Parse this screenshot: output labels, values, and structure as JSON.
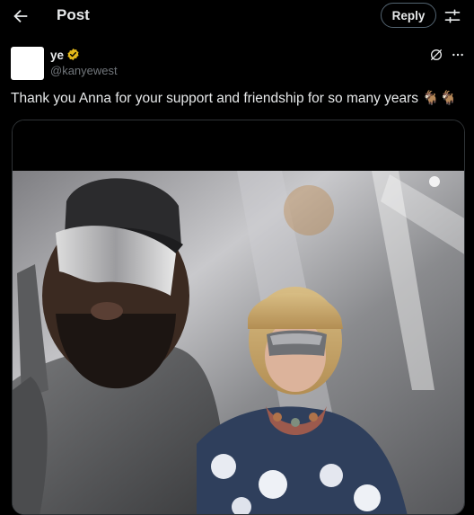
{
  "header": {
    "title": "Post",
    "reply_label": "Reply",
    "back_icon": "arrow-left-icon",
    "settings_icon": "sliders-icon"
  },
  "post": {
    "author_name": "ye",
    "author_handle": "@kanyewest",
    "verified_icon": "verified-badge-icon",
    "text": "Thank you Anna for your support and friendship for so many years 🐐🐐",
    "grok_icon": "grok-icon",
    "more_icon": "more-icon"
  },
  "colors": {
    "background": "#000000",
    "text": "#e7e9ea",
    "muted": "#71767b",
    "border": "#2f3336",
    "verified": "#e2b719"
  }
}
